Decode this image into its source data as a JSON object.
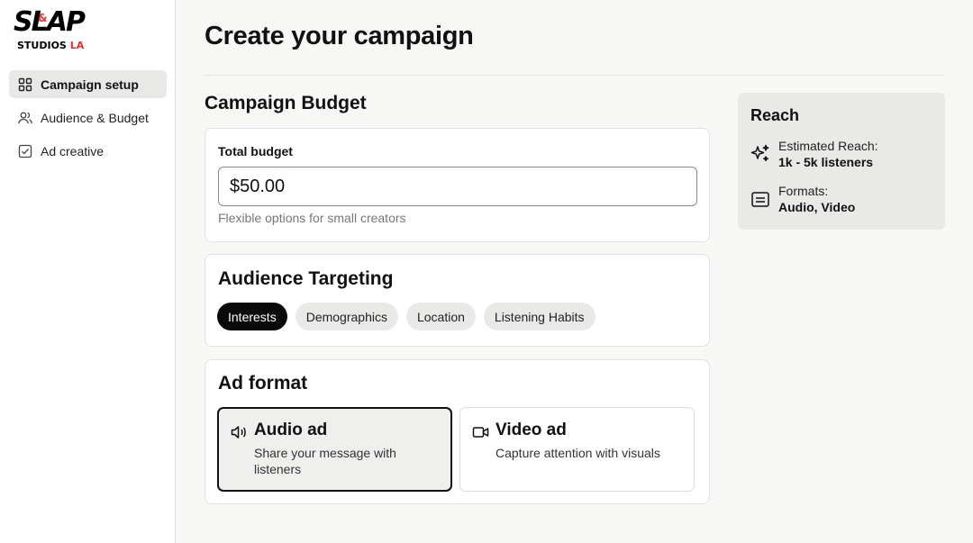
{
  "logo": {
    "line1": "SLAP",
    "amp": "&",
    "line2": "STUDIOS",
    "line2_accent": "LA"
  },
  "sidebar": {
    "items": [
      {
        "label": "Campaign setup",
        "icon": "grid-icon",
        "active": true
      },
      {
        "label": "Audience & Budget",
        "icon": "users-icon",
        "active": false
      },
      {
        "label": "Ad creative",
        "icon": "checkbox-icon",
        "active": false
      }
    ]
  },
  "main": {
    "title": "Create your campaign",
    "budget_section": {
      "title": "Campaign Budget",
      "label": "Total budget",
      "value": "$50.00",
      "helper": "Flexible options for small creators"
    },
    "audience": {
      "title": "Audience Targeting",
      "chips": [
        {
          "label": "Interests",
          "selected": true
        },
        {
          "label": "Demographics",
          "selected": false
        },
        {
          "label": "Location",
          "selected": false
        },
        {
          "label": "Listening Habits",
          "selected": false
        }
      ]
    },
    "ad_format": {
      "title": "Ad format",
      "options": [
        {
          "title": "Audio ad",
          "description": "Share your message with listeners",
          "icon": "speaker-icon",
          "selected": true
        },
        {
          "title": "Video ad",
          "description": "Capture attention with visuals",
          "icon": "video-camera-icon",
          "selected": false
        }
      ]
    }
  },
  "reach": {
    "title": "Reach",
    "estimated_label": "Estimated Reach:",
    "estimated_value": "1k - 5k listeners",
    "formats_label": "Formats:",
    "formats_value": "Audio, Video"
  },
  "colors": {
    "accent": "#0a0a0a",
    "brand_red": "#e0322e",
    "panel": "#e9e9e7",
    "background": "#f7f7f6"
  }
}
